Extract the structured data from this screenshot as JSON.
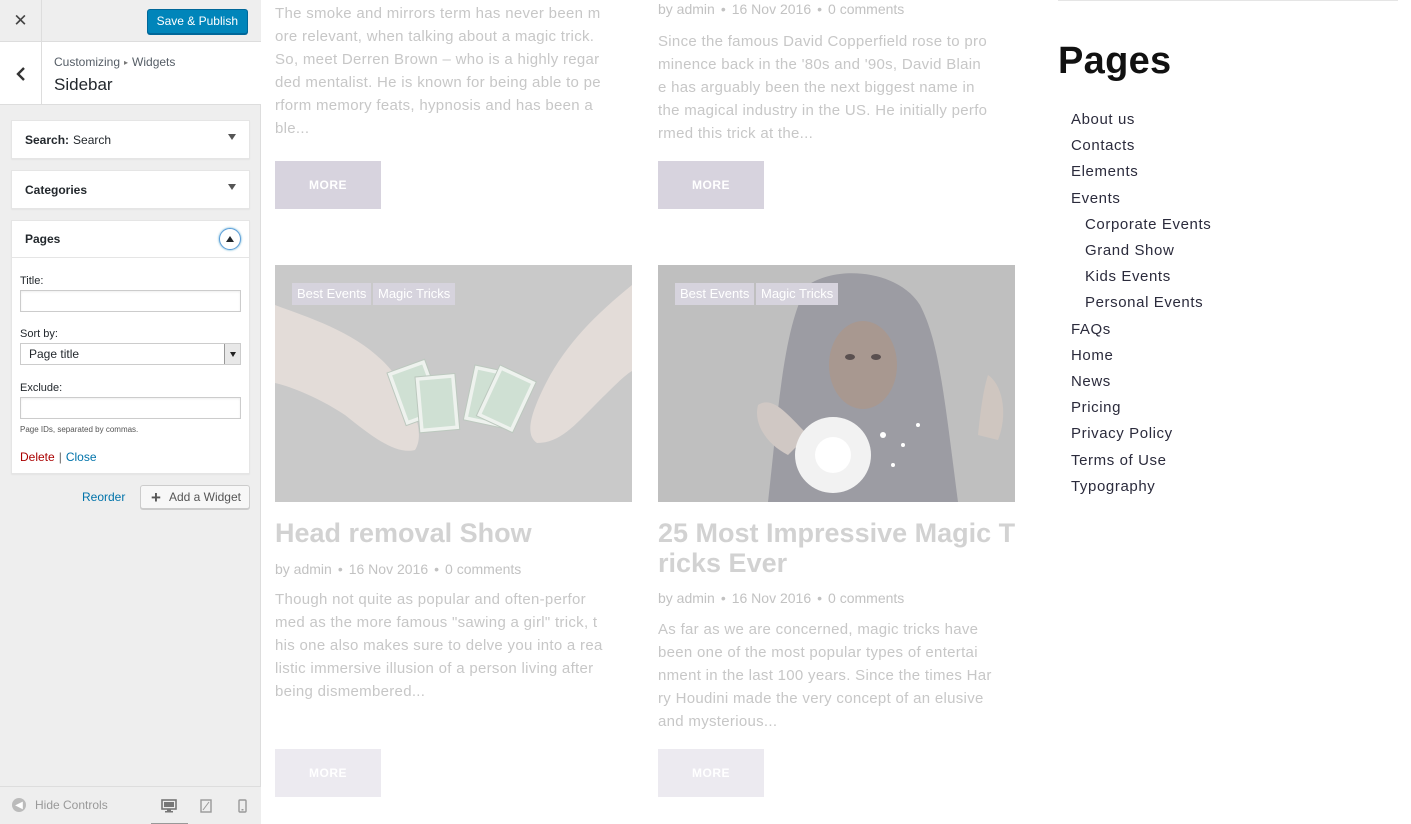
{
  "header": {
    "close_label": "✕",
    "save_publish": "Save & Publish"
  },
  "section": {
    "back_label": "‹",
    "breadcrumb_root": "Customizing",
    "breadcrumb_sep": "▸",
    "breadcrumb_parent": "Widgets",
    "title": "Sidebar"
  },
  "widgets": {
    "search": {
      "name": "Search:",
      "subtitle": "Search"
    },
    "categories": {
      "name": "Categories"
    },
    "pages": {
      "name": "Pages",
      "title_label": "Title:",
      "title_value": "",
      "sort_label": "Sort by:",
      "sort_value": "Page title",
      "exclude_label": "Exclude:",
      "exclude_value": "",
      "exclude_desc": "Page IDs, separated by commas.",
      "delete": "Delete",
      "separator": "|",
      "close": "Close"
    }
  },
  "actions": {
    "reorder": "Reorder",
    "add_widget": "Add a Widget"
  },
  "footer": {
    "hide_controls": "Hide Controls"
  },
  "preview": {
    "posts_top": [
      {
        "text": [
          "The smoke and mirrors term has never been m",
          "ore relevant, when talking about a magic trick.",
          "So, meet Derren Brown – who is a highly regar",
          "ded mentalist. He is known for being able to pe",
          "rform memory feats, hypnosis and has been a",
          "ble..."
        ],
        "more": "MORE"
      },
      {
        "meta": {
          "author": "by admin",
          "date": "16 Nov 2016",
          "comments": "0 comments"
        },
        "text": [
          "Since the famous David Copperfield rose to pro",
          "minence back in the '80s and '90s, David Blain",
          "e has arguably been the next biggest name in",
          "the magical industry in the US. He initially perfo",
          "rmed this trick at the..."
        ],
        "more": "MORE"
      }
    ],
    "posts_bottom": [
      {
        "tags": [
          "Best Events",
          "Magic Tricks"
        ],
        "title": [
          "Head removal Show"
        ],
        "meta": {
          "author": "by admin",
          "date": "16 Nov 2016",
          "comments": "0 comments"
        },
        "text": [
          "Though not quite as popular and often-perfor",
          "med as the more famous \"sawing a girl\" trick, t",
          "his one also makes sure to delve you into a rea",
          "listic immersive illusion of a person living after",
          "being dismembered..."
        ],
        "more": "MORE"
      },
      {
        "tags": [
          "Best Events",
          "Magic Tricks"
        ],
        "title": [
          "25 Most Impressive Magic T",
          "ricks Ever"
        ],
        "meta": {
          "author": "by admin",
          "date": "16 Nov 2016",
          "comments": "0 comments"
        },
        "text": [
          "As far as we are concerned, magic tricks have",
          "been one of the most popular types of entertai",
          "nment in the last 100 years. Since the times Har",
          "ry Houdini made the very concept of an elusive",
          "and mysterious..."
        ],
        "more": "MORE"
      }
    ],
    "sidebar": {
      "title": "Pages",
      "pages": [
        {
          "label": "About us",
          "level": 0
        },
        {
          "label": "Contacts",
          "level": 0
        },
        {
          "label": "Elements",
          "level": 0
        },
        {
          "label": "Events",
          "level": 0
        },
        {
          "label": "Corporate Events",
          "level": 1
        },
        {
          "label": "Grand Show",
          "level": 1
        },
        {
          "label": "Kids Events",
          "level": 1
        },
        {
          "label": "Personal Events",
          "level": 1
        },
        {
          "label": "FAQs",
          "level": 0
        },
        {
          "label": "Home",
          "level": 0
        },
        {
          "label": "News",
          "level": 0
        },
        {
          "label": "Pricing",
          "level": 0
        },
        {
          "label": "Privacy Policy",
          "level": 0
        },
        {
          "label": "Terms of Use",
          "level": 0
        },
        {
          "label": "Typography",
          "level": 0
        }
      ]
    }
  },
  "colors": {
    "accent": "#0085ba",
    "link": "#0073aa",
    "delete": "#aa0000",
    "button_muted": "#d7d3de"
  }
}
